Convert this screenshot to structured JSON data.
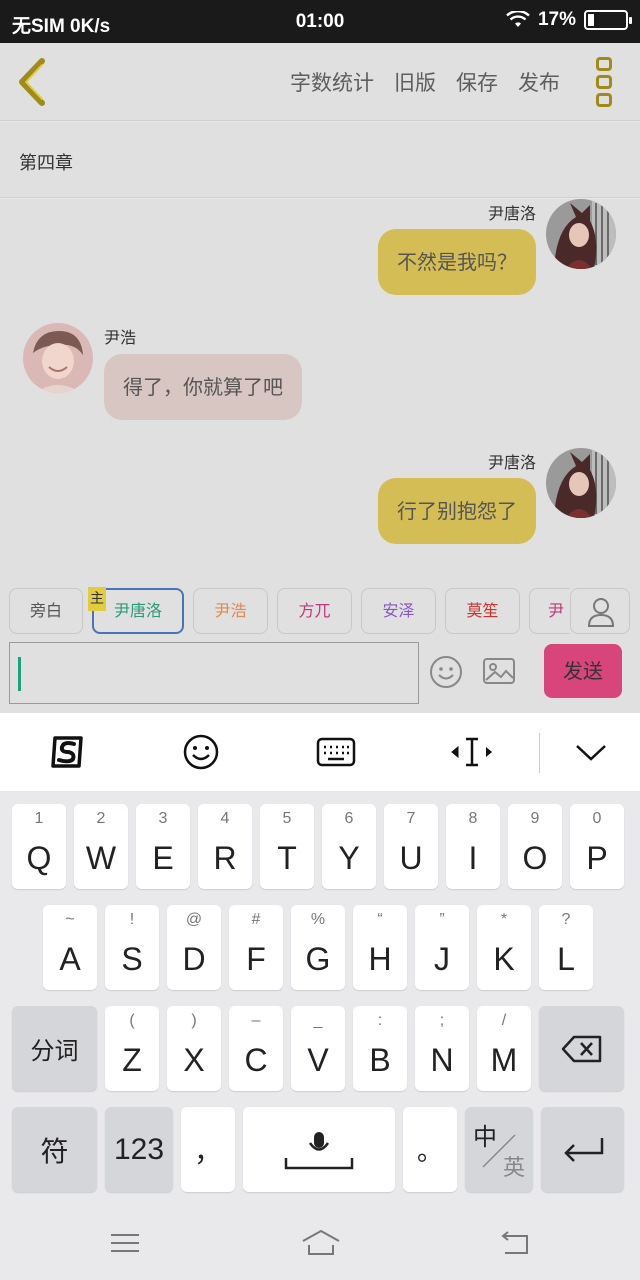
{
  "status_bar": {
    "carrier": "无SIM 0K/s",
    "time": "01:00",
    "battery": "17%"
  },
  "header": {
    "actions": [
      "字数统计",
      "旧版",
      "保存",
      "发布"
    ]
  },
  "chapter": {
    "title": "第四章"
  },
  "messages": [
    {
      "sender": "尹唐洛",
      "text": "不然是我吗？",
      "side": "right"
    },
    {
      "sender": "尹浩",
      "text": "得了，你就算了吧",
      "side": "left"
    },
    {
      "sender": "尹唐洛",
      "text": "行了别抱怨了",
      "side": "right"
    }
  ],
  "characters": {
    "main_badge": "主",
    "items": [
      {
        "label": "旁白",
        "color": "#555555"
      },
      {
        "label": "尹唐洛",
        "color": "#2a9a7a"
      },
      {
        "label": "尹浩",
        "color": "#e08a52"
      },
      {
        "label": "方兀",
        "color": "#c2367c"
      },
      {
        "label": "安泽",
        "color": "#8a55c8"
      },
      {
        "label": "莫笙",
        "color": "#d03030"
      },
      {
        "label": "尹",
        "color": "#c2367c"
      }
    ]
  },
  "input": {
    "send_label": "发送"
  },
  "keyboard": {
    "row1": [
      {
        "sub": "1",
        "main": "Q"
      },
      {
        "sub": "2",
        "main": "W"
      },
      {
        "sub": "3",
        "main": "E"
      },
      {
        "sub": "4",
        "main": "R"
      },
      {
        "sub": "5",
        "main": "T"
      },
      {
        "sub": "6",
        "main": "Y"
      },
      {
        "sub": "7",
        "main": "U"
      },
      {
        "sub": "8",
        "main": "I"
      },
      {
        "sub": "9",
        "main": "O"
      },
      {
        "sub": "0",
        "main": "P"
      }
    ],
    "row2": [
      {
        "sub": "~",
        "main": "A"
      },
      {
        "sub": "!",
        "main": "S"
      },
      {
        "sub": "@",
        "main": "D"
      },
      {
        "sub": "#",
        "main": "F"
      },
      {
        "sub": "%",
        "main": "G"
      },
      {
        "sub": "“",
        "main": "H"
      },
      {
        "sub": "”",
        "main": "J"
      },
      {
        "sub": "*",
        "main": "K"
      },
      {
        "sub": "?",
        "main": "L"
      }
    ],
    "row3": [
      {
        "sub": "(",
        "main": "Z"
      },
      {
        "sub": ")",
        "main": "X"
      },
      {
        "sub": "–",
        "main": "C"
      },
      {
        "sub": "_",
        "main": "V"
      },
      {
        "sub": ":",
        "main": "B"
      },
      {
        "sub": ";",
        "main": "N"
      },
      {
        "sub": "/",
        "main": "M"
      }
    ],
    "segment_label": "分词",
    "symbol_label": "符",
    "num_label": "123",
    "comma": "，",
    "period": "。",
    "lang_top": "中",
    "lang_bottom": "英"
  }
}
